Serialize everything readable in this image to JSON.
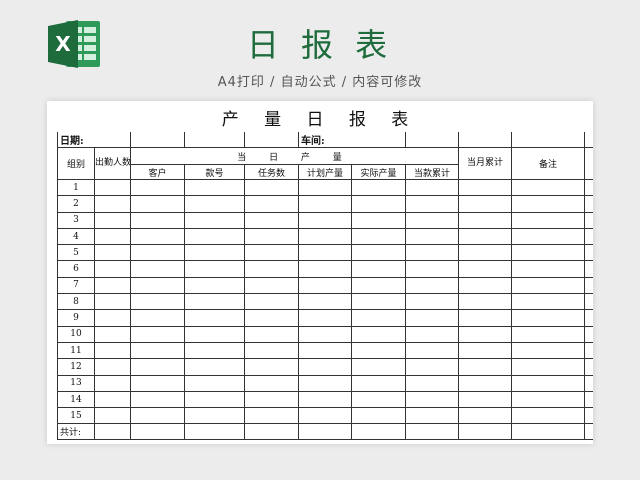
{
  "header": {
    "title": "日 报 表",
    "subtitle": "A4打印 / 自动公式 / 内容可修改",
    "logo_letter": "X",
    "brand_color": "#1e6b3c"
  },
  "sheet": {
    "title": "产 量 日 报 表",
    "date_label": "日期:",
    "workshop_label": "车间:",
    "headers": {
      "group": "组别",
      "attendance": "出勤人数",
      "daily_output": "当 日 产 量",
      "customer": "客户",
      "style_no": "款号",
      "task_qty": "任务数",
      "planned_output": "计划产量",
      "actual_output": "实际产量",
      "cumulative": "当款累计",
      "monthly_total": "当月累计",
      "remarks": "备注"
    },
    "rows": [
      "1",
      "2",
      "3",
      "4",
      "5",
      "6",
      "7",
      "8",
      "9",
      "10",
      "11",
      "12",
      "13",
      "14",
      "15"
    ],
    "total_label": "共计:"
  }
}
